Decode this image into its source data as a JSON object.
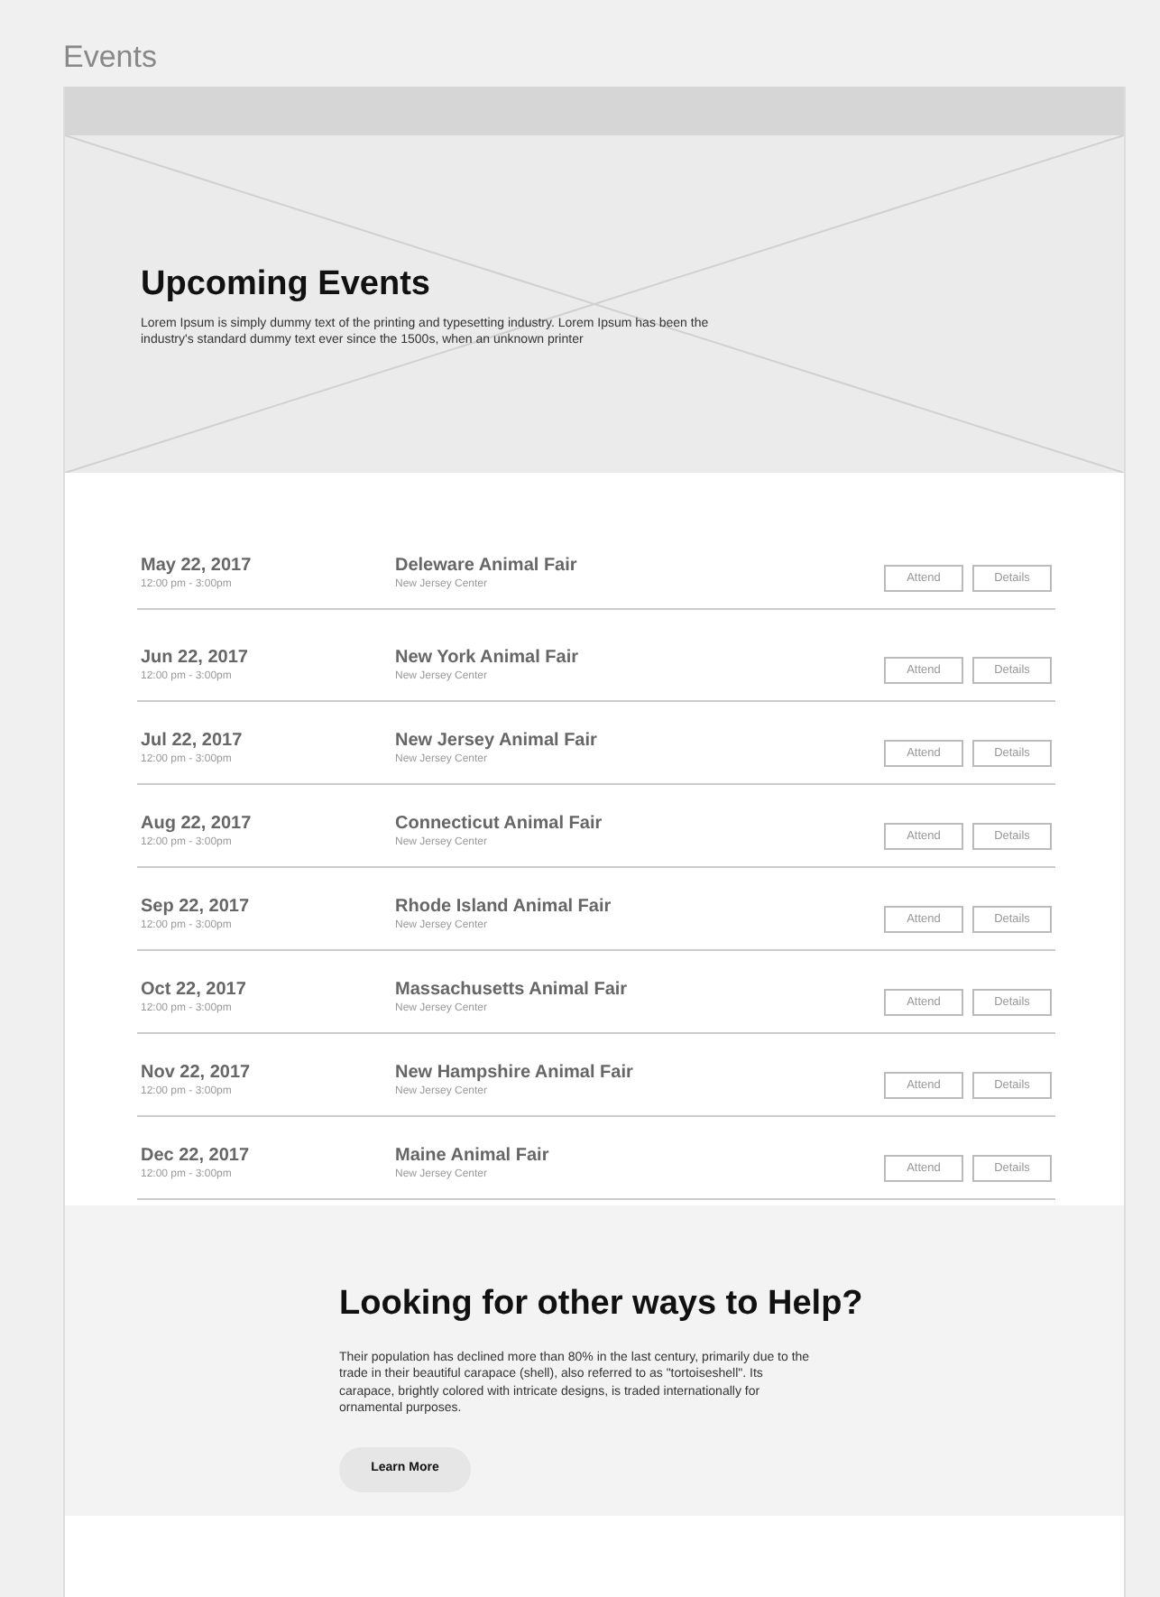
{
  "page_title": "Events",
  "hero": {
    "title": "Upcoming Events",
    "text": "Lorem Ipsum is simply dummy text of the printing and typesetting industry. Lorem Ipsum has been the industry's standard dummy text ever since the 1500s, when an unknown printer"
  },
  "events": [
    {
      "date": "May 22, 2017",
      "time": "12:00 pm - 3:00pm",
      "title": "Deleware Animal Fair",
      "venue": "New Jersey Center",
      "actions": [
        "Attend",
        "Details"
      ]
    },
    {
      "date": "Jun 22, 2017",
      "time": "12:00 pm - 3:00pm",
      "title": "New York Animal Fair",
      "venue": "New Jersey Center",
      "actions": [
        "Attend",
        "Details"
      ]
    },
    {
      "date": "Jul 22, 2017",
      "time": "12:00 pm - 3:00pm",
      "title": "New Jersey Animal Fair",
      "venue": "New Jersey Center",
      "actions": [
        "Attend",
        "Details"
      ]
    },
    {
      "date": "Aug 22, 2017",
      "time": "12:00 pm - 3:00pm",
      "title": "Connecticut Animal Fair",
      "venue": "New Jersey Center",
      "actions": [
        "Attend",
        "Details"
      ]
    },
    {
      "date": "Sep 22, 2017",
      "time": "12:00 pm - 3:00pm",
      "title": "Rhode Island Animal Fair",
      "venue": "New Jersey Center",
      "actions": [
        "Attend",
        "Details"
      ]
    },
    {
      "date": "Oct 22, 2017",
      "time": "12:00 pm - 3:00pm",
      "title": "Massachusetts Animal Fair",
      "venue": "New Jersey Center",
      "actions": [
        "Attend",
        "Details"
      ]
    },
    {
      "date": "Nov 22, 2017",
      "time": "12:00 pm - 3:00pm",
      "title": "New Hampshire Animal Fair",
      "venue": "New Jersey Center",
      "actions": [
        "Attend",
        "Details"
      ]
    },
    {
      "date": "Dec 22, 2017",
      "time": "12:00 pm - 3:00pm",
      "title": "Maine Animal Fair",
      "venue": "New Jersey Center",
      "actions": [
        "Attend",
        "Details"
      ]
    }
  ],
  "help": {
    "title": "Looking for other ways to Help?",
    "text": "Their population has declined more than 80% in the last century, primarily due to the trade in their beautiful carapace (shell), also referred to as \"tortoiseshell\". Its carapace, brightly colored with intricate designs, is traded internationally for ornamental purposes.",
    "button": "Learn More"
  }
}
